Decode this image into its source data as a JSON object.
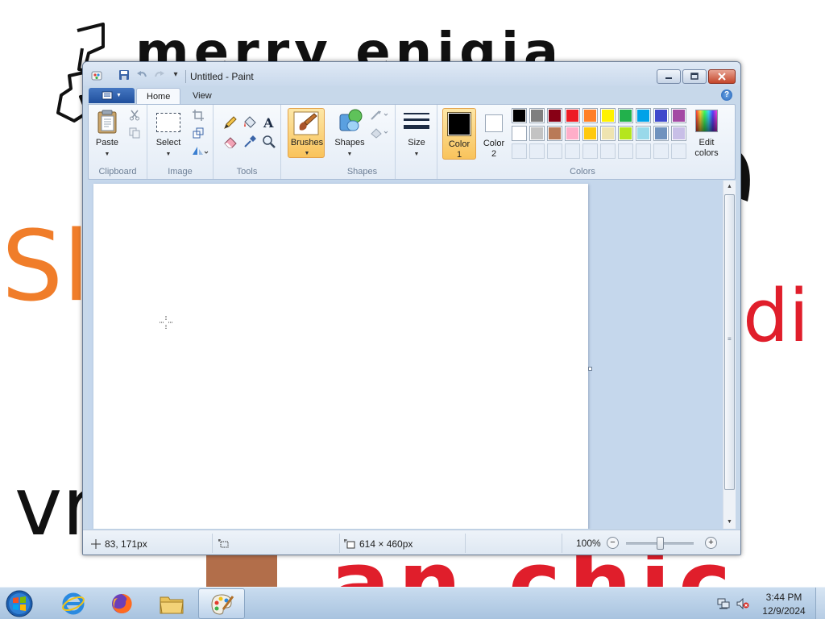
{
  "wallpaper": {
    "line1": "merry enigia",
    "line2": "Sl",
    "line3": "di",
    "line4": "vr",
    "line5": "an chic"
  },
  "window": {
    "title": "Untitled - Paint",
    "quick_access": {
      "save_icon": "save-icon",
      "undo_icon": "undo-icon",
      "redo_icon": "redo-icon",
      "customize_glyph": "▾"
    },
    "caption_buttons": {
      "minimize_icon": "minimize-icon",
      "maximize_icon": "maximize-icon",
      "close_icon": "close-icon"
    }
  },
  "ribbon": {
    "tabs": [
      {
        "label": "Home",
        "active": true
      },
      {
        "label": "View",
        "active": false
      }
    ],
    "help_glyph": "?",
    "groups": {
      "clipboard": {
        "label": "Clipboard",
        "paste_label": "Paste"
      },
      "image": {
        "label": "Image",
        "select_label": "Select"
      },
      "tools": {
        "label": "Tools"
      },
      "brushes": {
        "label": "Brushes"
      },
      "shapes": {
        "label": "Shapes",
        "shapes_label": "Shapes"
      },
      "size": {
        "label": "Size"
      },
      "colors": {
        "label": "Colors",
        "color1_label": "Color",
        "color1_num": "1",
        "color2_label": "Color",
        "color2_num": "2",
        "edit_label": "Edit",
        "edit_label2": "colors",
        "color1_value": "#000000",
        "color2_value": "#ffffff",
        "palette_row1": [
          "#000000",
          "#7f7f7f",
          "#880015",
          "#ed1c24",
          "#ff7f27",
          "#fff200",
          "#22b14c",
          "#00a2e8",
          "#3f48cc",
          "#a349a4"
        ],
        "palette_row2": [
          "#ffffff",
          "#c3c3c3",
          "#b97a57",
          "#ffaec9",
          "#ffc90e",
          "#efe4b0",
          "#b5e61d",
          "#99d9ea",
          "#7092be",
          "#c8bfe7"
        ]
      }
    }
  },
  "statusbar": {
    "cursor_position": "83, 171px",
    "canvas_size": "614 × 460px",
    "zoom": "100%",
    "zoom_out_glyph": "−",
    "zoom_in_glyph": "+",
    "zoom_fraction": 0.5
  },
  "taskbar": {
    "apps": [
      {
        "name": "Internet Explorer",
        "icon": "internet-explorer-icon"
      },
      {
        "name": "Firefox",
        "icon": "firefox-icon"
      },
      {
        "name": "Windows Explorer",
        "icon": "folder-icon"
      },
      {
        "name": "Paint",
        "icon": "paint-icon",
        "active": true
      }
    ],
    "clock_time": "3:44 PM",
    "clock_date": "12/9/2024"
  }
}
